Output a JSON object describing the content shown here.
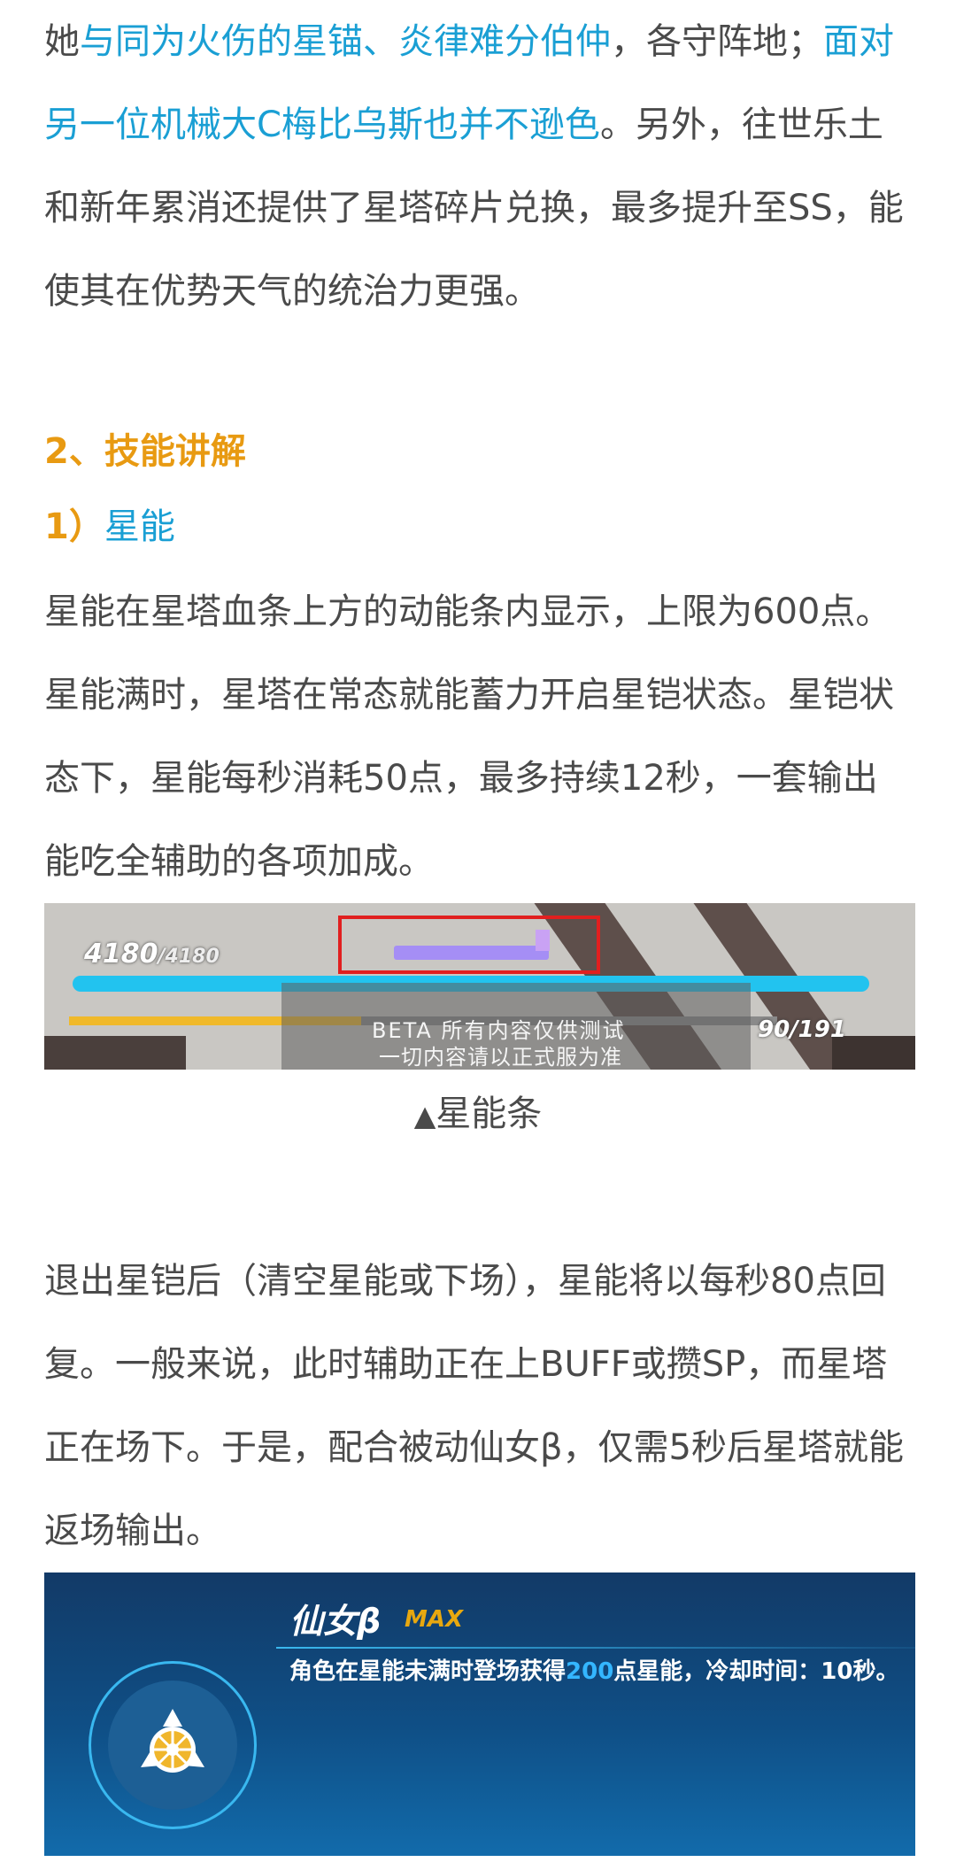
{
  "intro": {
    "lead": "她",
    "link1": "与同为火伤的星锚、炎律难分伯仲",
    "mid1": "，各守阵地；",
    "link2": "面对另一位机械大C梅比乌斯也并不逊色",
    "rest": "。另外，往世乐土和新年累消还提供了星塔碎片兑换，最多提升至SS，能使其在优势天气的统治力更强。"
  },
  "section": {
    "title": "2、技能讲解",
    "sub_num": "1）",
    "sub_label": "星能"
  },
  "para_energy": "星能在星塔血条上方的动能条内显示，上限为600点。星能满时，星塔在常态就能蓄力开启星铠状态。星铠状态下，星能每秒消耗50点，最多持续12秒，一套输出能吃全辅助的各项加成。",
  "screenshot_energy": {
    "hp_current": "4180",
    "hp_max": "/4180",
    "beta_line1": "BETA 所有内容仅供测试",
    "beta_line2": "一切内容请以正式服为准",
    "sp": "90/191",
    "energy_fill": 0.28
  },
  "caption": {
    "icon": "▲",
    "text": "星能条"
  },
  "para_recover": "退出星铠后（清空星能或下场），星能将以每秒80点回复。一般来说，此时辅助正在上BUFF或攒SP，而星塔正在场下。于是，配合被动仙女β，仅需5秒后星塔就能返场输出。",
  "skill_card": {
    "title": "仙女β",
    "badge": "MAX",
    "desc_before": "角色在星能未满时登场获得",
    "desc_num": "200",
    "desc_after": "点星能，冷却时间：10秒。",
    "icon_name": "wheel-gear-icon"
  },
  "colors": {
    "link": "#1a9fd4",
    "heading": "#e89a12",
    "text": "#4a4a4a"
  }
}
